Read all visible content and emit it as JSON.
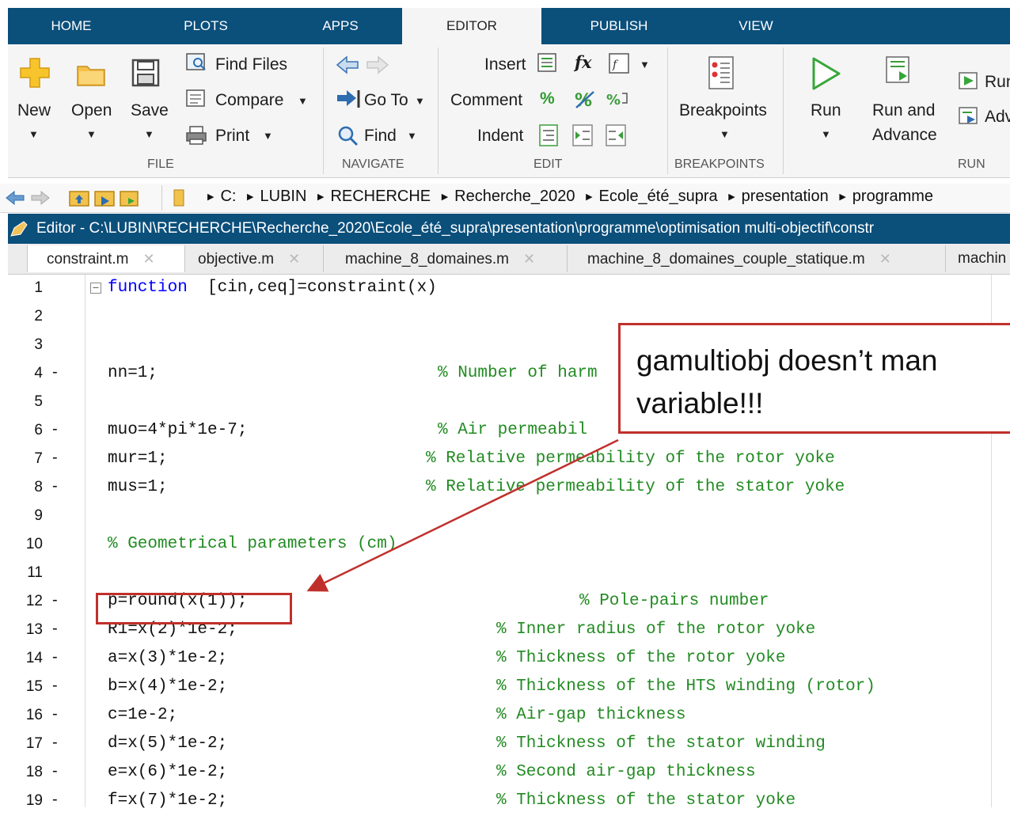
{
  "ribbon": {
    "tabs": [
      "HOME",
      "PLOTS",
      "APPS",
      "EDITOR",
      "PUBLISH",
      "VIEW"
    ],
    "active_tab": "EDITOR",
    "file": {
      "new": "New",
      "open": "Open",
      "save": "Save",
      "find_files": "Find Files",
      "compare": "Compare",
      "print": "Print",
      "section": "FILE"
    },
    "navigate": {
      "goto": "Go To",
      "find": "Find",
      "section": "NAVIGATE"
    },
    "edit": {
      "insert": "Insert",
      "fx": "fx",
      "comment": "Comment",
      "percent": "%",
      "indent": "Indent",
      "section": "EDIT"
    },
    "breakpoints": {
      "label": "Breakpoints",
      "section": "BREAKPOINTS"
    },
    "run": {
      "run": "Run",
      "run_and": "Run and",
      "advance": "Advance",
      "run_section": "Run",
      "adv": "Adv",
      "section": "RUN"
    }
  },
  "address": {
    "crumbs": [
      "C:",
      "LUBIN",
      "RECHERCHE",
      "Recherche_2020",
      "Ecole_été_supra",
      "presentation",
      "programme"
    ]
  },
  "editor_title": "Editor - C:\\LUBIN\\RECHERCHE\\Recherche_2020\\Ecole_été_supra\\presentation\\programme\\optimisation multi-objectif\\constr",
  "file_tabs": [
    "constraint.m",
    "objective.m",
    "machine_8_domaines.m",
    "machine_8_domaines_couple_statique.m",
    "machin"
  ],
  "code": {
    "lines": [
      {
        "n": "1",
        "mark": "",
        "code": "function [cin,ceq]=constraint(x)",
        "comment": ""
      },
      {
        "n": "2",
        "mark": "",
        "code": "",
        "comment": ""
      },
      {
        "n": "3",
        "mark": "",
        "code": "",
        "comment": ""
      },
      {
        "n": "4",
        "mark": "-",
        "code": "nn=1;",
        "comment": "% Number of harm"
      },
      {
        "n": "5",
        "mark": "",
        "code": "",
        "comment": ""
      },
      {
        "n": "6",
        "mark": "-",
        "code": "muo=4*pi*1e-7;",
        "comment": "% Air permeabil"
      },
      {
        "n": "7",
        "mark": "-",
        "code": "mur=1;",
        "comment": "% Relative permeability of the rotor yoke"
      },
      {
        "n": "8",
        "mark": "-",
        "code": "mus=1;",
        "comment": "% Relative permeability of the stator yoke"
      },
      {
        "n": "9",
        "mark": "",
        "code": "",
        "comment": ""
      },
      {
        "n": "10",
        "mark": "",
        "code": "",
        "comment": "% Geometrical parameters (cm)"
      },
      {
        "n": "11",
        "mark": "",
        "code": "",
        "comment": ""
      },
      {
        "n": "12",
        "mark": "-",
        "code": "p=round(x(1));",
        "comment": "% Pole-pairs number"
      },
      {
        "n": "13",
        "mark": "-",
        "code": "R1=x(2)*1e-2;",
        "comment": "% Inner radius of the rotor yoke"
      },
      {
        "n": "14",
        "mark": "-",
        "code": "a=x(3)*1e-2;",
        "comment": "% Thickness of the rotor yoke"
      },
      {
        "n": "15",
        "mark": "-",
        "code": "b=x(4)*1e-2;",
        "comment": "% Thickness of the HTS winding (rotor)"
      },
      {
        "n": "16",
        "mark": "-",
        "code": "c=1e-2;",
        "comment": "% Air-gap thickness"
      },
      {
        "n": "17",
        "mark": "-",
        "code": "d=x(5)*1e-2;",
        "comment": "% Thickness of the stator winding"
      },
      {
        "n": "18",
        "mark": "-",
        "code": "e=x(6)*1e-2;",
        "comment": "% Second air-gap thickness"
      },
      {
        "n": "19",
        "mark": "-",
        "code": "f=x(7)*1e-2;",
        "comment": "% Thickness of the stator yoke"
      }
    ]
  },
  "annotation": {
    "line1": "gamultiobj doesn’t man",
    "line2": "variable!!!"
  },
  "colors": {
    "ribbon_blue": "#0b4f7b",
    "keyword": "#0000ff",
    "comment": "#228b22",
    "annotation_red": "#c0302b"
  }
}
